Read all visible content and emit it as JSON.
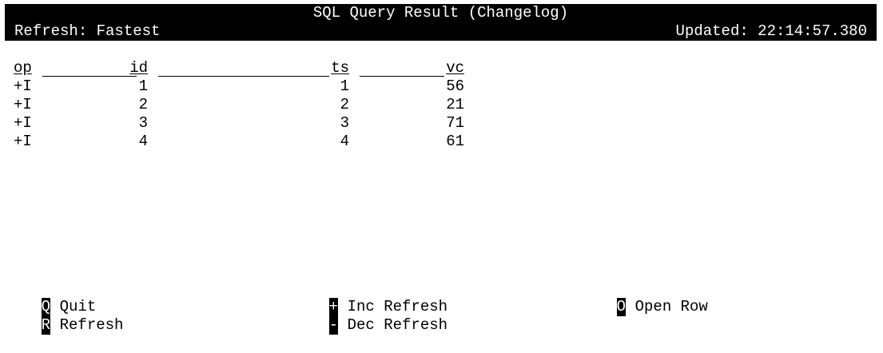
{
  "header": {
    "title": "SQL Query Result (Changelog)",
    "refresh": "Refresh: Fastest",
    "updated": "Updated: 22:14:57.380"
  },
  "table": {
    "columns": [
      "op",
      "id",
      "ts",
      "vc"
    ],
    "rows": [
      [
        "+I",
        "1",
        "1",
        "56"
      ],
      [
        "+I",
        "2",
        "2",
        "21"
      ],
      [
        "+I",
        "3",
        "3",
        "71"
      ],
      [
        "+I",
        "4",
        "4",
        "61"
      ]
    ]
  },
  "footer": {
    "items": [
      {
        "key": "Q",
        "label": "Quit"
      },
      {
        "key": "R",
        "label": "Refresh"
      },
      {
        "key": "+",
        "label": "Inc Refresh"
      },
      {
        "key": "-",
        "label": "Dec Refresh"
      },
      {
        "key": "O",
        "label": "Open Row"
      }
    ]
  }
}
